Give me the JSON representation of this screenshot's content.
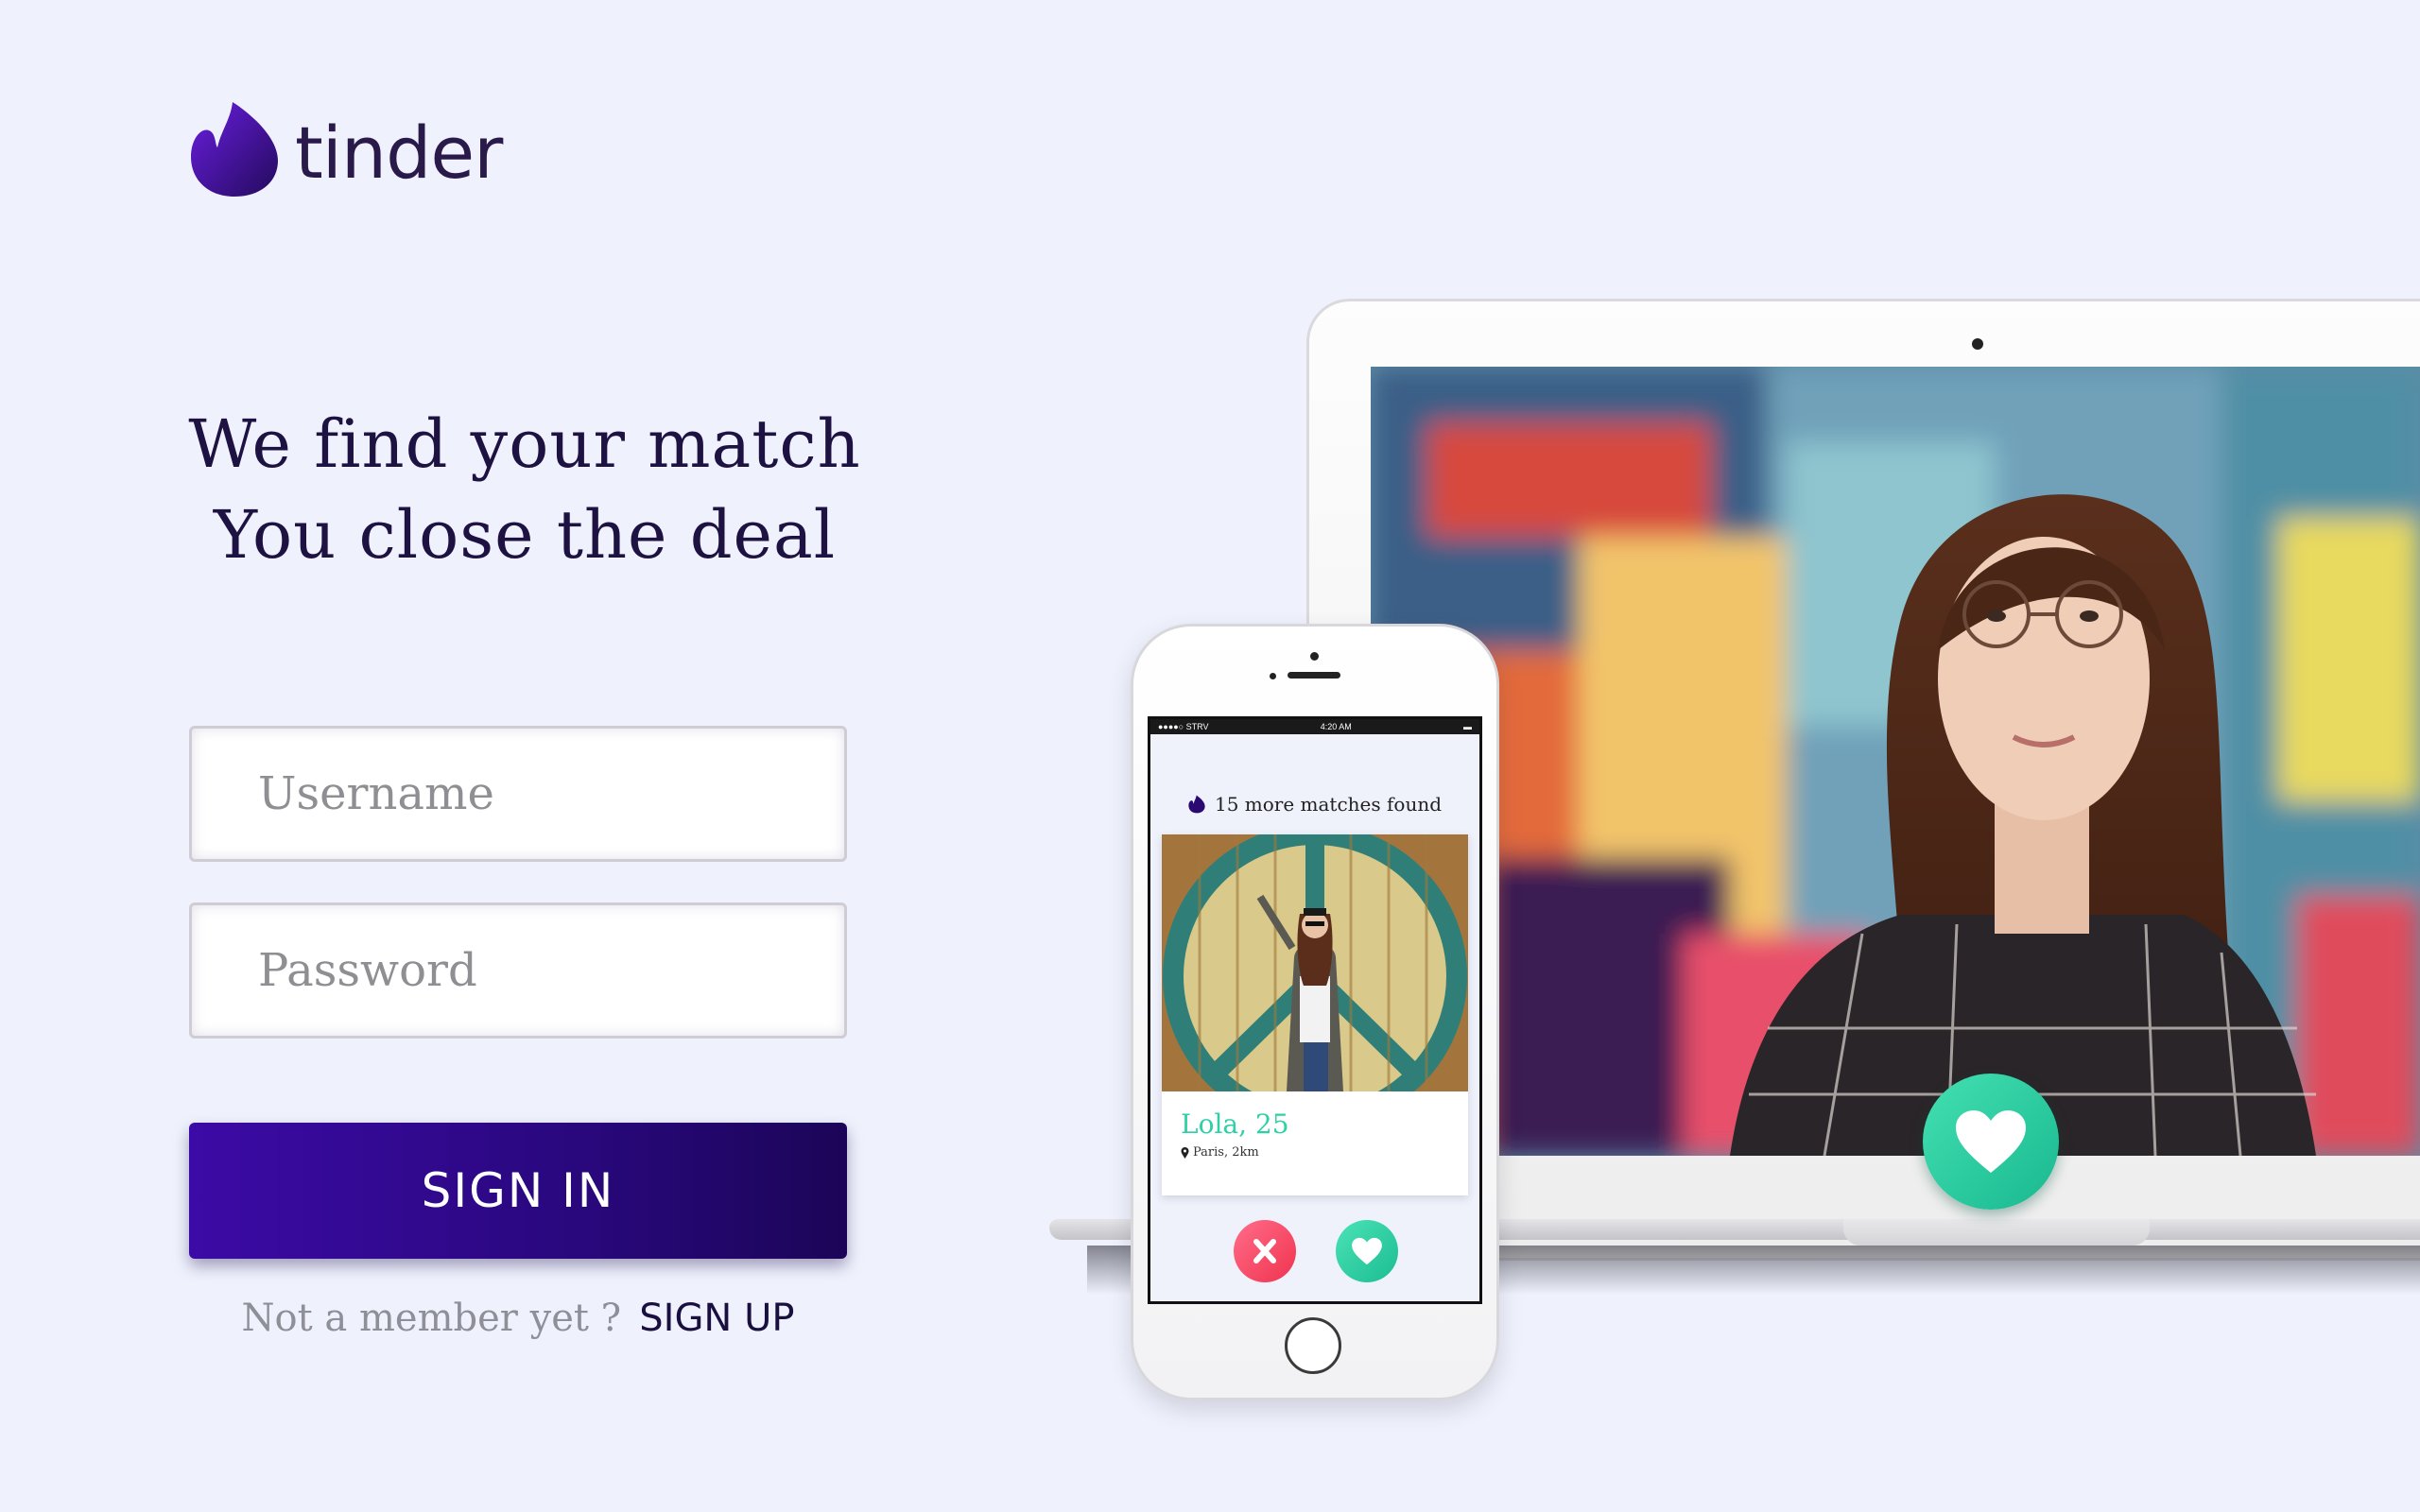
{
  "brand": {
    "name": "tinder"
  },
  "hero": {
    "line1": "We find your match",
    "line2": "You close the deal"
  },
  "form": {
    "username_placeholder": "Username",
    "password_placeholder": "Password",
    "signin_label": "SIGN IN",
    "signup_prompt": "Not a member yet ?",
    "signup_label": "SIGN UP"
  },
  "phone": {
    "status_carrier": "●●●●○ STRV",
    "status_time": "4:20 AM",
    "matches_text": "15 more matches found",
    "card_name": "Lola, 25",
    "card_location": "Paris, 2km"
  },
  "colors": {
    "background": "#eff2fd",
    "brand_purple": "#2a0880",
    "like_green": "#1cbc92",
    "nope_red": "#f0334e"
  },
  "icons": {
    "logo": "flame-icon",
    "like": "heart-icon",
    "nope": "close-icon",
    "location": "pin-icon"
  }
}
